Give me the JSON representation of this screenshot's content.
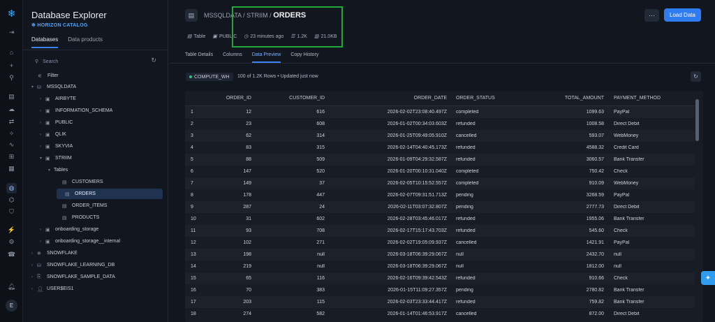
{
  "sidebar": {
    "title": "Database Explorer",
    "catalog": "HORIZON CATALOG",
    "tabs": [
      "Databases",
      "Data products"
    ],
    "search_placeholder": "Search",
    "filter_label": "Filter",
    "tree": [
      {
        "label": "MSSQLDATA",
        "icon": "database-icon",
        "expanded": true
      },
      {
        "label": "AIRBYTE",
        "icon": "schema-icon"
      },
      {
        "label": "INFORMATION_SCHEMA",
        "icon": "schema-icon"
      },
      {
        "label": "PUBLIC",
        "icon": "schema-icon"
      },
      {
        "label": "QLIK",
        "icon": "schema-icon"
      },
      {
        "label": "SKYVIA",
        "icon": "schema-icon"
      },
      {
        "label": "STRIIM",
        "icon": "schema-icon",
        "expanded": true
      },
      {
        "label": "Tables",
        "icon": "",
        "expanded": true
      },
      {
        "label": "CUSTOMERS",
        "icon": "table-icon"
      },
      {
        "label": "ORDERS",
        "icon": "table-icon",
        "selected": true
      },
      {
        "label": "ORDER_ITEMS",
        "icon": "table-icon"
      },
      {
        "label": "PRODUCTS",
        "icon": "table-icon"
      },
      {
        "label": "onboarding_storage",
        "icon": "schema-icon"
      },
      {
        "label": "onboarding_storage__internal",
        "icon": "schema-icon"
      },
      {
        "label": "SNOWFLAKE",
        "icon": "snowflake-icon"
      },
      {
        "label": "SNOWFLAKE_LEARNING_DB",
        "icon": "database-icon"
      },
      {
        "label": "SNOWFLAKE_SAMPLE_DATA",
        "icon": "share-icon"
      },
      {
        "label": "USER$EIS1",
        "icon": "user-icon"
      }
    ]
  },
  "rail": {
    "avatar": "E"
  },
  "header": {
    "breadcrumb_prefix": "MSSQLDATA / STRIIM / ",
    "current": "ORDERS",
    "meta": {
      "type": "Table",
      "schema": "PUBLIC",
      "updated": "23 minutes ago",
      "rows": "1.2K",
      "size": "21.0KB"
    },
    "load_button": "Load Data",
    "more_button": "···"
  },
  "tabs": [
    "Table Details",
    "Columns",
    "Data Preview",
    "Copy History"
  ],
  "active_tab": "Data Preview",
  "preview": {
    "warehouse": "COMPUTE_WH",
    "summary": "100 of 1.2K Rows • Updated just now"
  },
  "table": {
    "columns": [
      "ORDER_ID",
      "CUSTOMER_ID",
      "ORDER_DATE",
      "ORDER_STATUS",
      "TOTAL_AMOUNT",
      "PAYMENT_METHOD"
    ],
    "rows": [
      [
        "1",
        "12",
        "616",
        "2026-02-02T23:08:40.497Z",
        "completed",
        "1099.63",
        "PayPal"
      ],
      [
        "2",
        "23",
        "608",
        "2026-01-02T00:34:03.603Z",
        "refunded",
        "1008.58",
        "Direct Debit"
      ],
      [
        "3",
        "62",
        "314",
        "2026-01-25T09:49:05.910Z",
        "cancelled",
        "593.07",
        "WebMoney"
      ],
      [
        "4",
        "83",
        "315",
        "2026-02-14T04:40:45.173Z",
        "refunded",
        "4588.32",
        "Credit Card"
      ],
      [
        "5",
        "88",
        "509",
        "2026-01-09T04:29:32.587Z",
        "refunded",
        "3060.57",
        "Bank Transfer"
      ],
      [
        "6",
        "147",
        "520",
        "2026-01-20T00:10:31.040Z",
        "completed",
        "750.42",
        "Check"
      ],
      [
        "7",
        "149",
        "37",
        "2026-02-05T10:15:52.557Z",
        "completed",
        "910.09",
        "WebMoney"
      ],
      [
        "8",
        "178",
        "447",
        "2026-02-07T09:31:51.713Z",
        "pending",
        "3268.59",
        "PayPal"
      ],
      [
        "9",
        "287",
        "24",
        "2026-02-11T03:07:32.807Z",
        "pending",
        "2777.73",
        "Direct Debit"
      ],
      [
        "10",
        "31",
        "602",
        "2026-02-28T03:45:46.017Z",
        "refunded",
        "1955.06",
        "Bank Transfer"
      ],
      [
        "11",
        "93",
        "708",
        "2026-02-17T15:17:43.703Z",
        "refunded",
        "545.60",
        "Check"
      ],
      [
        "12",
        "102",
        "271",
        "2026-02-02T19:05:09.937Z",
        "cancelled",
        "1421.91",
        "PayPal"
      ],
      [
        "13",
        "198",
        "null",
        "2026-03-18T06:39:29.067Z",
        "null",
        "2432.70",
        "null"
      ],
      [
        "14",
        "219",
        "null",
        "2026-03-18T06:39:29.067Z",
        "null",
        "1812.00",
        "null"
      ],
      [
        "15",
        "65",
        "116",
        "2026-02-16T09:39:42.543Z",
        "refunded",
        "910.66",
        "Check"
      ],
      [
        "16",
        "70",
        "383",
        "2026-01-15T11:09:27.357Z",
        "pending",
        "2780.82",
        "Bank Transfer"
      ],
      [
        "17",
        "203",
        "115",
        "2026-02-03T23:33:44.417Z",
        "refunded",
        "759.82",
        "Bank Transfer"
      ],
      [
        "18",
        "274",
        "582",
        "2026-01-14T01:46:53.917Z",
        "cancelled",
        "872.00",
        "Direct Debit"
      ]
    ]
  },
  "colors": {
    "accent": "#2f7bf0",
    "highlight_box": "#22a83a",
    "selected_row": "#1f3250"
  }
}
